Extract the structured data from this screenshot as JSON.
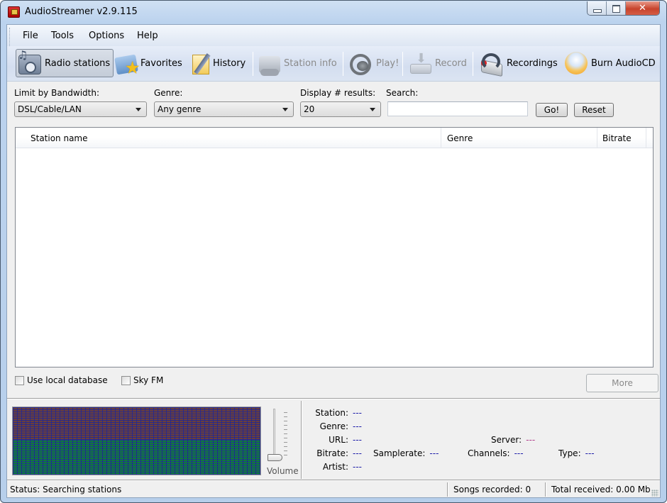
{
  "window": {
    "title": "AudioStreamer v2.9.115",
    "icon": "app-icon",
    "controls": [
      "minimize",
      "maximize",
      "close"
    ]
  },
  "menu": {
    "items": [
      {
        "label": "File"
      },
      {
        "label": "Tools"
      },
      {
        "label": "Options"
      },
      {
        "label": "Help"
      }
    ]
  },
  "toolbar": {
    "buttons": [
      {
        "label": "Radio stations",
        "icon": "radio-icon",
        "active": true,
        "enabled": true
      },
      {
        "label": "Favorites",
        "icon": "favorites-star-icon",
        "active": false,
        "enabled": true
      },
      {
        "label": "History",
        "icon": "history-notepad-icon",
        "active": false,
        "enabled": true
      },
      {
        "label": "Station info",
        "icon": "station-info-icon",
        "active": false,
        "enabled": false
      },
      {
        "label": "Play!",
        "icon": "headphones-icon",
        "active": false,
        "enabled": false
      },
      {
        "label": "Record",
        "icon": "record-drive-icon",
        "active": false,
        "enabled": false
      },
      {
        "label": "Recordings",
        "icon": "recordings-icon",
        "active": false,
        "enabled": true
      },
      {
        "label": "Burn AudioCD",
        "icon": "burn-cd-icon",
        "active": false,
        "enabled": true
      }
    ]
  },
  "filters": {
    "bandwidth": {
      "label": "Limit by Bandwidth:",
      "value": "DSL/Cable/LAN"
    },
    "genre": {
      "label": "Genre:",
      "value": "Any genre"
    },
    "results": {
      "label": "Display # results:",
      "value": "20"
    },
    "search": {
      "label": "Search:",
      "value": "",
      "placeholder": ""
    },
    "go_label": "Go!",
    "reset_label": "Reset"
  },
  "station_list": {
    "columns": [
      {
        "label": "Station name"
      },
      {
        "label": "Genre"
      },
      {
        "label": "Bitrate"
      }
    ],
    "rows": []
  },
  "options": {
    "use_local_database": {
      "label": "Use local database",
      "checked": false
    },
    "sky_fm": {
      "label": "Sky FM",
      "checked": false
    },
    "more_label": "More"
  },
  "player": {
    "volume_label": "Volume",
    "volume_level": 0,
    "info": {
      "station": {
        "label": "Station:",
        "value": "---"
      },
      "genre": {
        "label": "Genre:",
        "value": "---"
      },
      "url": {
        "label": "URL:",
        "value": "---"
      },
      "server": {
        "label": "Server:",
        "value": "---"
      },
      "bitrate": {
        "label": "Bitrate:",
        "value": "---"
      },
      "samplerate": {
        "label": "Samplerate:",
        "value": "---"
      },
      "channels": {
        "label": "Channels:",
        "value": "---"
      },
      "type": {
        "label": "Type:",
        "value": "---"
      },
      "artist": {
        "label": "Artist:",
        "value": "---"
      }
    }
  },
  "statusbar": {
    "status": "Status: Searching stations",
    "songs_recorded": "Songs recorded: 0",
    "total_received": "Total received: 0.00 Mb"
  },
  "colors": {
    "info_value": "#1a1aa8",
    "server_value": "#b03a8a",
    "viz_top": "#6b3f3a",
    "viz_bottom": "#0f7a3a"
  }
}
